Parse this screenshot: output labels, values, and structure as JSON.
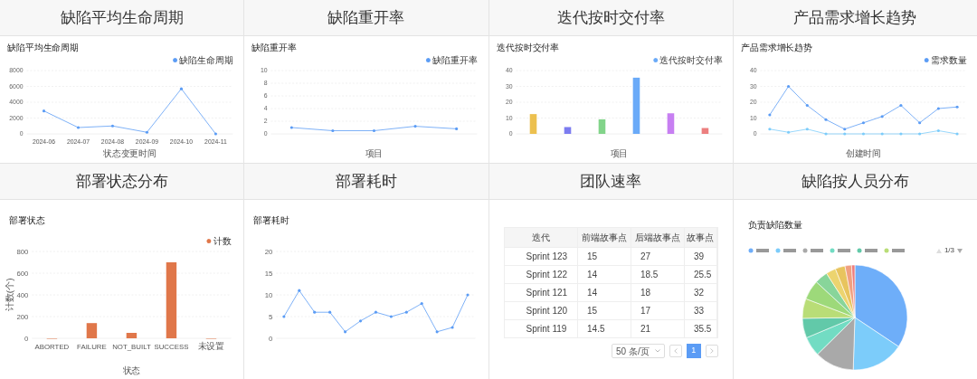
{
  "cards": [
    {
      "kind": "chart",
      "title": "缺陷平均生命周期",
      "chart_data": {
        "type": "line",
        "title": "缺陷平均生命周期",
        "xlabel": "状态变更时间",
        "categories": [
          "2024-06",
          "2024-07",
          "2024-08",
          "2024-09",
          "2024-10",
          "2024-11"
        ],
        "ylim": [
          0,
          8000
        ],
        "yticks": [
          0,
          2000,
          4000,
          6000,
          8000
        ],
        "grid": true,
        "series": [
          {
            "name": "缺陷生命周期",
            "color": "#5b9cf5",
            "values": [
              2900,
              800,
              1000,
              200,
              5700,
              0
            ]
          }
        ]
      }
    },
    {
      "kind": "chart",
      "title": "缺陷重开率",
      "chart_data": {
        "type": "line",
        "title": "缺陷重开率",
        "xlabel": "项目",
        "ylim": [
          0,
          10
        ],
        "yticks": [
          0,
          2,
          4,
          6,
          8,
          10
        ],
        "grid": true,
        "series": [
          {
            "name": "缺陷重开率",
            "color": "#5b9cf5",
            "values": [
              1,
              0.5,
              0.5,
              1.2,
              0.8
            ]
          }
        ]
      }
    },
    {
      "kind": "chart",
      "title": "迭代按时交付率",
      "chart_data": {
        "type": "bar",
        "title": "迭代按时交付率",
        "xlabel": "项目",
        "ylim": [
          0,
          40
        ],
        "yticks": [
          0,
          10,
          20,
          30,
          40
        ],
        "grid": true,
        "stacked": true,
        "series": [
          {
            "name": "迭代按时交付率",
            "color": "#6aaaf8",
            "values": [
              null,
              null,
              null,
              35.5,
              null,
              null
            ]
          },
          {
            "color": "#ecc04f",
            "values": [
              12.5,
              null,
              null,
              null,
              null,
              null
            ]
          },
          {
            "color": "#7c7cf0",
            "values": [
              null,
              4.3,
              null,
              null,
              null,
              null
            ]
          },
          {
            "color": "#82d48a",
            "values": [
              null,
              null,
              9.2,
              null,
              null,
              null
            ]
          },
          {
            "color": "#c77ff2",
            "values": [
              null,
              null,
              null,
              null,
              13,
              null
            ]
          },
          {
            "color": "#ec7f7f",
            "values": [
              null,
              null,
              null,
              null,
              null,
              3.7
            ]
          }
        ]
      }
    },
    {
      "kind": "chart",
      "title": "产品需求增长趋势",
      "chart_data": {
        "type": "line",
        "title": "产品需求增长趋势",
        "xlabel": "创建时间",
        "ylim": [
          0,
          40
        ],
        "yticks": [
          0,
          10,
          20,
          30,
          40
        ],
        "grid": true,
        "series": [
          {
            "name": "需求数量",
            "color": "#5b9cf5",
            "values": [
              12,
              30,
              18,
              9,
              3,
              7,
              11,
              18,
              7,
              16,
              17
            ]
          },
          {
            "color": "#7cccfa",
            "values": [
              3,
              1,
              3,
              0,
              0,
              0,
              0,
              0,
              0,
              2,
              0
            ]
          }
        ]
      }
    },
    {
      "kind": "chart",
      "title": "部署状态分布",
      "chart_data": {
        "type": "bar",
        "title": "部署状态",
        "xlabel": "状态",
        "ylabel": "计数(个)",
        "categories": [
          "ABORTED",
          "FAILURE",
          "NOT_BUILT",
          "SUCCESS",
          "未设置"
        ],
        "ylim": [
          0,
          800
        ],
        "yticks": [
          0,
          200,
          400,
          600,
          800
        ],
        "grid": true,
        "series": [
          {
            "name": "计数",
            "color": "#e0774a",
            "values": [
              0,
              140,
              50,
              700,
              0
            ]
          }
        ]
      }
    },
    {
      "kind": "chart",
      "title": "部署耗时",
      "chart_data": {
        "type": "line",
        "title": "部署耗时",
        "ylim": [
          0,
          20
        ],
        "yticks": [
          0,
          5,
          10,
          15,
          20
        ],
        "grid": true,
        "series": [
          {
            "color": "#5b9cf5",
            "values": [
              5,
              11,
              6,
              6,
              1.5,
              4,
              6,
              5,
              6,
              8,
              1.5,
              2.5,
              10
            ]
          }
        ]
      }
    },
    {
      "kind": "table",
      "title": "团队速率",
      "table": {
        "columns": [
          "迭代",
          "前端故事点",
          "后端故事点",
          "故事点"
        ],
        "rows": [
          [
            "Sprint 123",
            "15",
            "27",
            "39"
          ],
          [
            "Sprint 122",
            "14",
            "18.5",
            "25.5"
          ],
          [
            "Sprint 121",
            "14",
            "18",
            "32"
          ],
          [
            "Sprint 120",
            "15",
            "17",
            "33"
          ],
          [
            "Sprint 119",
            "14.5",
            "21",
            "35.5"
          ]
        ],
        "page_size": "50 条/页",
        "pages": [
          {
            "label": "1",
            "selected": true
          }
        ]
      }
    },
    {
      "kind": "pie",
      "title": "缺陷按人员分布",
      "pie": {
        "title": "负责缺陷数量",
        "page_indicator": "1/3"
      }
    }
  ]
}
